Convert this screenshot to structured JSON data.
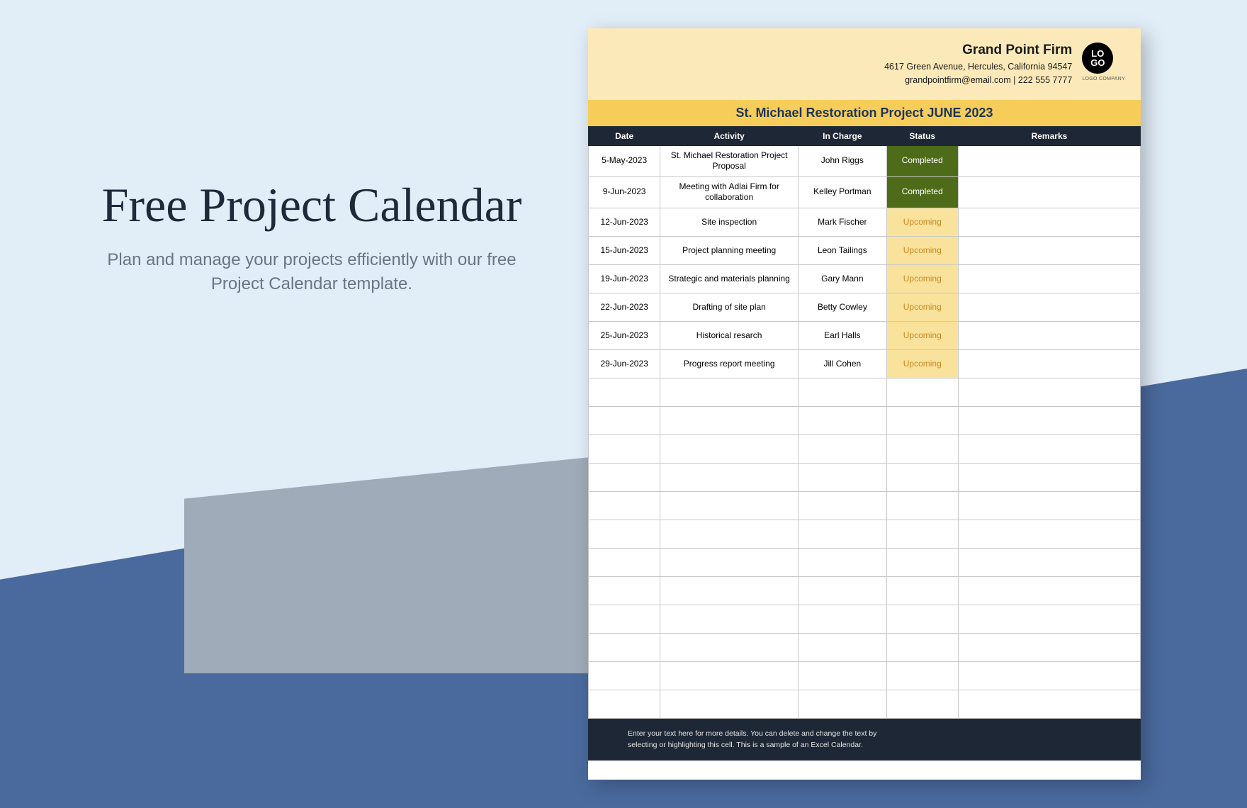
{
  "left": {
    "title": "Free Project Calendar",
    "subtitle": "Plan and manage your projects efficiently with our free Project Calendar template."
  },
  "header": {
    "firm": "Grand Point Firm",
    "address": "4617 Green Avenue, Hercules, California 94547",
    "contact": "grandpointfirm@email.com | 222 555 7777",
    "logo_text": "LO\nGO",
    "logo_caption": "LOGO COMPANY"
  },
  "title_bar": "St. Michael Restoration Project  JUNE 2023",
  "columns": [
    "Date",
    "Activity",
    "In Charge",
    "Status",
    "Remarks"
  ],
  "status_styles": {
    "Completed": "status-completed",
    "Upcoming": "status-upcoming"
  },
  "rows": [
    {
      "date": "5-May-2023",
      "activity": "St. Michael Restoration Project Proposal",
      "in_charge": "John Riggs",
      "status": "Completed",
      "remarks": ""
    },
    {
      "date": "9-Jun-2023",
      "activity": "Meeting with Adlai Firm for collaboration",
      "in_charge": "Kelley Portman",
      "status": "Completed",
      "remarks": ""
    },
    {
      "date": "12-Jun-2023",
      "activity": "Site inspection",
      "in_charge": "Mark Fischer",
      "status": "Upcoming",
      "remarks": ""
    },
    {
      "date": "15-Jun-2023",
      "activity": "Project planning meeting",
      "in_charge": "Leon Tailings",
      "status": "Upcoming",
      "remarks": ""
    },
    {
      "date": "19-Jun-2023",
      "activity": "Strategic and materials planning",
      "in_charge": "Gary Mann",
      "status": "Upcoming",
      "remarks": ""
    },
    {
      "date": "22-Jun-2023",
      "activity": "Drafting of site plan",
      "in_charge": "Betty Cowley",
      "status": "Upcoming",
      "remarks": ""
    },
    {
      "date": "25-Jun-2023",
      "activity": "Historical resarch",
      "in_charge": "Earl Halls",
      "status": "Upcoming",
      "remarks": ""
    },
    {
      "date": "29-Jun-2023",
      "activity": "Progress report meeting",
      "in_charge": "Jill Cohen",
      "status": "Upcoming",
      "remarks": ""
    }
  ],
  "empty_rows": 12,
  "footer": "Enter your text here for more details. You can delete and change the text by selecting or highlighting this cell. This is a sample of an Excel Calendar."
}
